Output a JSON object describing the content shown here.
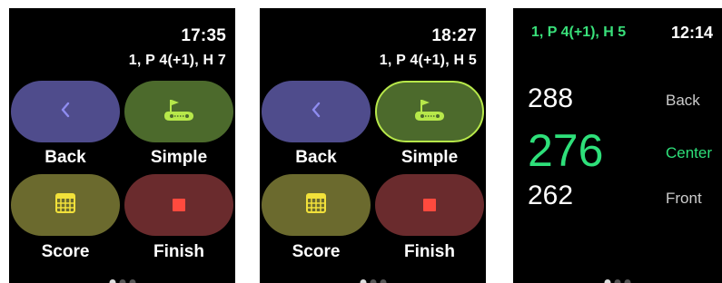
{
  "screens": [
    {
      "time": "17:35",
      "hole_info": "1, P 4(+1), H 7",
      "buttons": {
        "back": "Back",
        "simple": "Simple",
        "score": "Score",
        "finish": "Finish"
      },
      "simple_selected": false
    },
    {
      "time": "18:27",
      "hole_info": "1, P 4(+1), H 5",
      "buttons": {
        "back": "Back",
        "simple": "Simple",
        "score": "Score",
        "finish": "Finish"
      },
      "simple_selected": true
    },
    {
      "time": "12:14",
      "hole_info": "1, P 4(+1), H 5",
      "distances": {
        "back": "288",
        "center": "276",
        "front": "262"
      },
      "labels": {
        "back": "Back",
        "center": "Center",
        "front": "Front"
      }
    }
  ],
  "icons": {
    "back": "chevron-left-icon",
    "simple": "golf-hole-icon",
    "score": "scorecard-grid-icon",
    "finish": "stop-icon"
  },
  "colors": {
    "back_button": "#4f4c8c",
    "simple_button": "#4c6a2c",
    "score_button": "#6b6a2e",
    "finish_button": "#6a2b2d",
    "accent_green": "#2ee07a",
    "selection_border": "#b7e84a",
    "stop_red": "#ff4a3e"
  }
}
